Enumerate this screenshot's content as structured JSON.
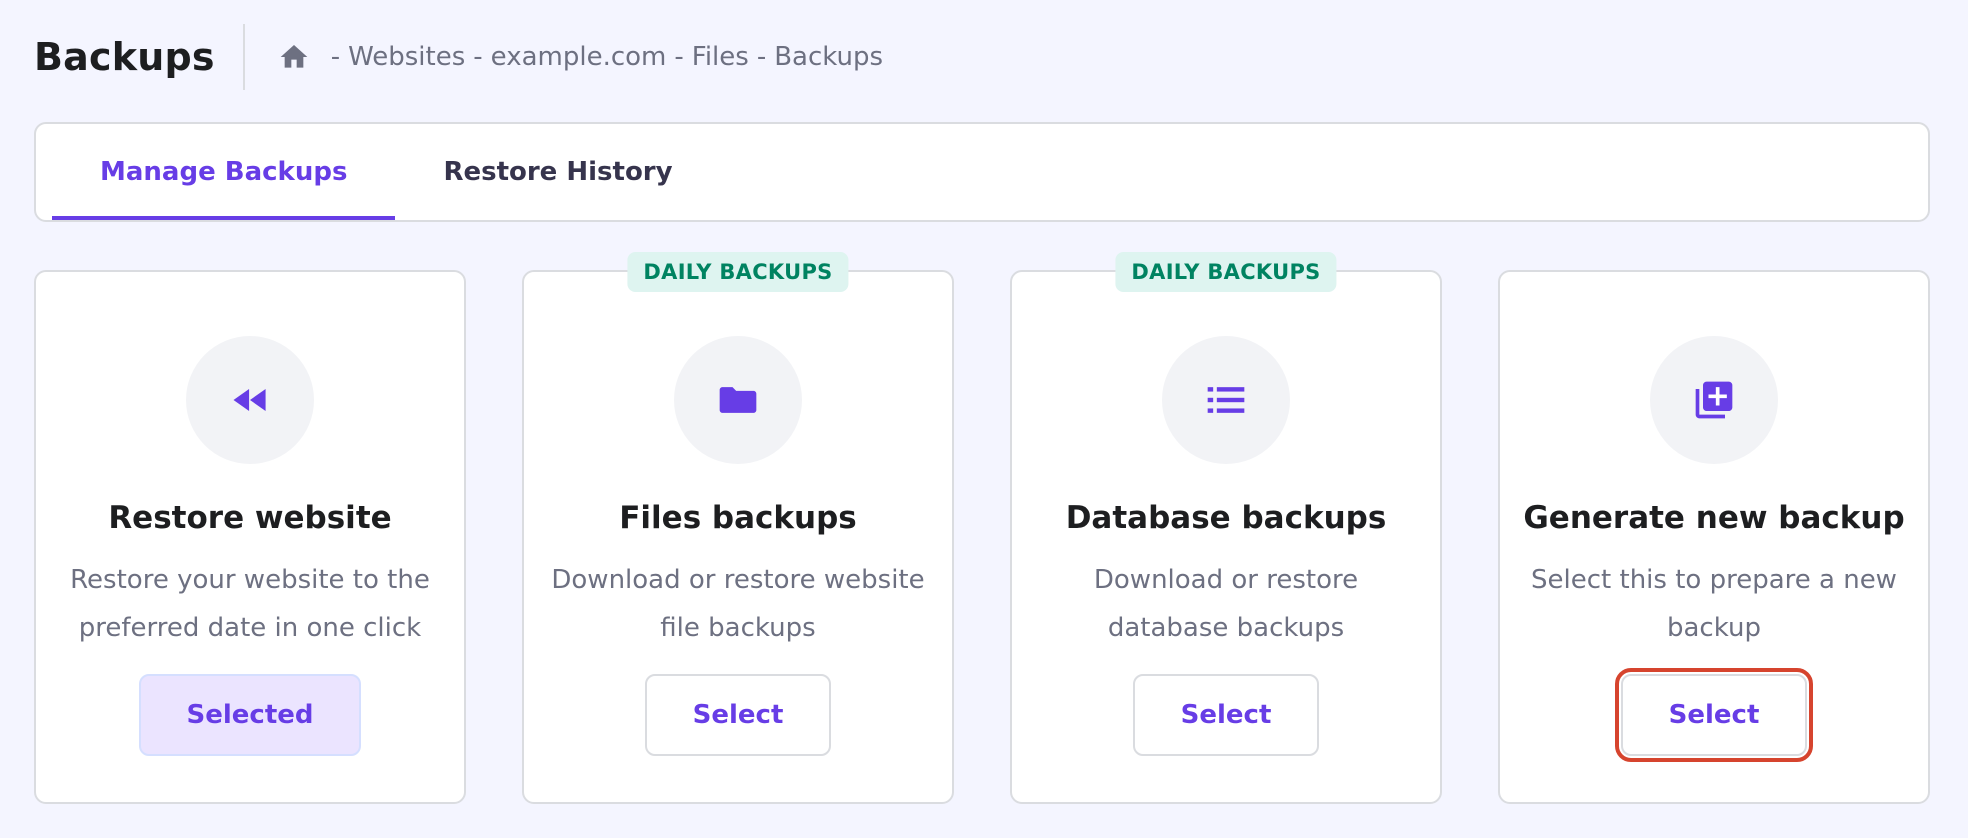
{
  "header": {
    "title": "Backups",
    "breadcrumb": {
      "home_icon": "home-icon",
      "separator": "-",
      "items": [
        "Websites",
        "example.com",
        "Files",
        "Backups"
      ]
    }
  },
  "tabs": [
    {
      "label": "Manage Backups",
      "active": true
    },
    {
      "label": "Restore History",
      "active": false
    }
  ],
  "cards": [
    {
      "icon": "rewind-icon",
      "badge": "",
      "title": "Restore website",
      "description": "Restore your website to the preferred date in one click",
      "button": "Selected"
    },
    {
      "icon": "folder-icon",
      "badge": "DAILY BACKUPS",
      "title": "Files backups",
      "description": "Download or restore website file backups",
      "button": "Select"
    },
    {
      "icon": "list-icon",
      "badge": "DAILY BACKUPS",
      "title": "Database backups",
      "description": "Download or restore database backups",
      "button": "Select"
    },
    {
      "icon": "add-library-icon",
      "badge": "",
      "title": "Generate new backup",
      "description": "Select this to prepare a new backup",
      "button": "Select"
    }
  ],
  "colors": {
    "accent": "#673de6",
    "badge_bg": "#def4f0",
    "badge_text": "#008361",
    "highlight_box": "#d6442e",
    "selected_bg": "#ebe4ff"
  }
}
